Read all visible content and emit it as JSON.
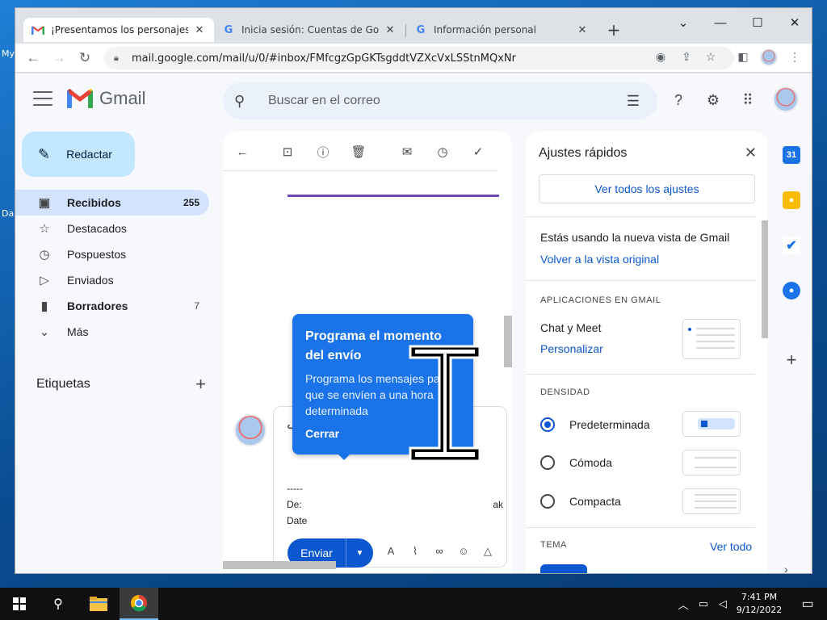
{
  "desktop": {
    "labels": [
      "My",
      "Da"
    ]
  },
  "browser": {
    "tabs": [
      {
        "title": "¡Presentamos los personajes de",
        "favicon": "gmail-icon",
        "active": true
      },
      {
        "title": "Inicia sesión: Cuentas de Google",
        "favicon": "google-icon",
        "active": false
      },
      {
        "title": "Información personal",
        "favicon": "google-icon",
        "active": false
      }
    ],
    "new_tab": "+",
    "url": "mail.google.com/mail/u/0/#inbox/FMfcgzGpGKTsgddtVZXcVxLSStnMQxNr"
  },
  "gmail": {
    "product_name": "Gmail",
    "search_placeholder": "Buscar en el correo",
    "compose_label": "Redactar",
    "nav": [
      {
        "label": "Recibidos",
        "count": "255",
        "icon": "inbox-icon"
      },
      {
        "label": "Destacados",
        "count": "",
        "icon": "star-icon"
      },
      {
        "label": "Pospuestos",
        "count": "",
        "icon": "clock-icon"
      },
      {
        "label": "Enviados",
        "count": "",
        "icon": "send-icon"
      },
      {
        "label": "Borradores",
        "count": "7",
        "icon": "draft-icon"
      },
      {
        "label": "Más",
        "count": "",
        "icon": "chevron-down-icon"
      }
    ],
    "labels_title": "Etiquetas",
    "reply": {
      "dashes": "-----",
      "from_prefix": "De:",
      "date_prefix": "Date",
      "trailing": "ak",
      "send_label": "Enviar"
    },
    "tooltip": {
      "title": "Programa el momento del envío",
      "body": "Programa los mensajes para que se envíen a una hora determinada",
      "close": "Cerrar"
    }
  },
  "quick_settings": {
    "title": "Ajustes rápidos",
    "see_all": "Ver todos los ajustes",
    "new_view_text": "Estás usando la nueva vista de Gmail",
    "back_link": "Volver a la vista original",
    "apps_section": "APLICACIONES EN GMAIL",
    "chat_meet": "Chat y Meet",
    "customize": "Personalizar",
    "density_section": "DENSIDAD",
    "density_options": [
      {
        "label": "Predeterminada",
        "selected": true
      },
      {
        "label": "Cómoda",
        "selected": false
      },
      {
        "label": "Compacta",
        "selected": false
      }
    ],
    "theme_section": "TEMA",
    "see_all_themes": "Ver todo"
  },
  "taskbar": {
    "time": "7:41 PM",
    "date": "9/12/2022"
  },
  "colors": {
    "accent": "#0b57d0",
    "tooltip": "#1a73e8",
    "nav_active": "#d3e3fd",
    "compose": "#c2e7ff"
  }
}
